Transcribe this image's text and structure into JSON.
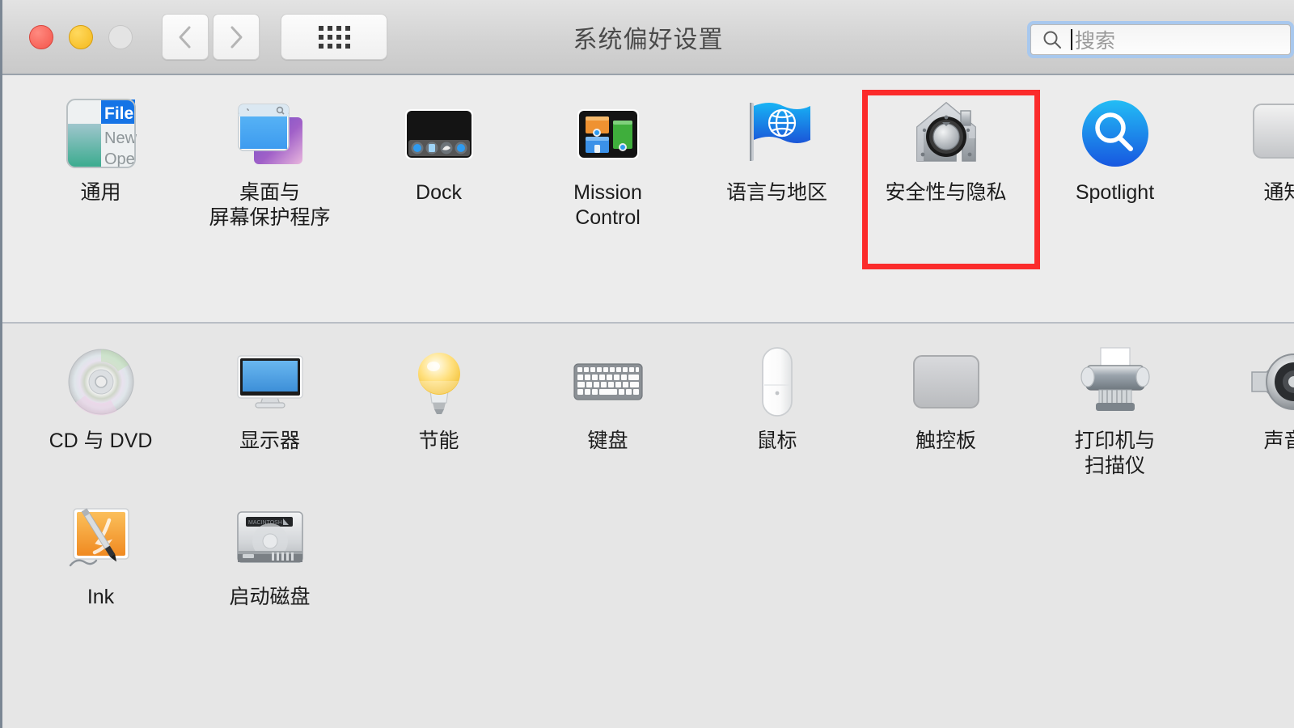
{
  "window": {
    "title": "系统偏好设置",
    "traffic_lights": [
      {
        "name": "close",
        "color": "#f4554b"
      },
      {
        "name": "minimize",
        "color": "#f5b91c"
      },
      {
        "name": "zoom",
        "color": "#e4e4e4"
      }
    ]
  },
  "toolbar": {
    "back_label": "",
    "forward_label": "",
    "show_all_label": "",
    "search": {
      "placeholder": "搜索",
      "value": "",
      "focused": true,
      "focus_ring_color": "#a8c8ee"
    }
  },
  "highlight": {
    "color": "#fb2b2b",
    "target": "安全性与隐私"
  },
  "sections": [
    {
      "name": "personal",
      "items": [
        {
          "label": "通用",
          "icon": "general-icon"
        },
        {
          "label": "桌面与\n屏幕保护程序",
          "line1": "桌面与",
          "line2": "屏幕保护程序",
          "icon": "desktop-screensaver-icon"
        },
        {
          "label": "Dock",
          "icon": "dock-icon"
        },
        {
          "label": "Mission\nControl",
          "line1": "Mission",
          "line2": "Control",
          "icon": "mission-control-icon"
        },
        {
          "label": "语言与地区",
          "icon": "language-region-icon"
        },
        {
          "label": "安全性与隐私",
          "icon": "security-privacy-icon",
          "highlighted": true
        },
        {
          "label": "Spotlight",
          "icon": "spotlight-icon"
        },
        {
          "label": "通知",
          "icon": "notifications-icon",
          "clipped": true
        }
      ]
    },
    {
      "name": "hardware",
      "rows": [
        [
          {
            "label": "CD 与 DVD",
            "icon": "cd-dvd-icon"
          },
          {
            "label": "显示器",
            "icon": "displays-icon"
          },
          {
            "label": "节能",
            "icon": "energy-saver-icon"
          },
          {
            "label": "键盘",
            "icon": "keyboard-icon"
          },
          {
            "label": "鼠标",
            "icon": "mouse-icon"
          },
          {
            "label": "触控板",
            "icon": "trackpad-icon"
          },
          {
            "label": "打印机与\n扫描仪",
            "line1": "打印机与",
            "line2": "扫描仪",
            "icon": "printers-scanners-icon"
          },
          {
            "label": "声音",
            "icon": "sound-icon",
            "clipped": true
          }
        ],
        [
          {
            "label": "Ink",
            "icon": "ink-icon"
          },
          {
            "label": "启动磁盘",
            "icon": "startup-disk-icon"
          }
        ]
      ]
    }
  ]
}
